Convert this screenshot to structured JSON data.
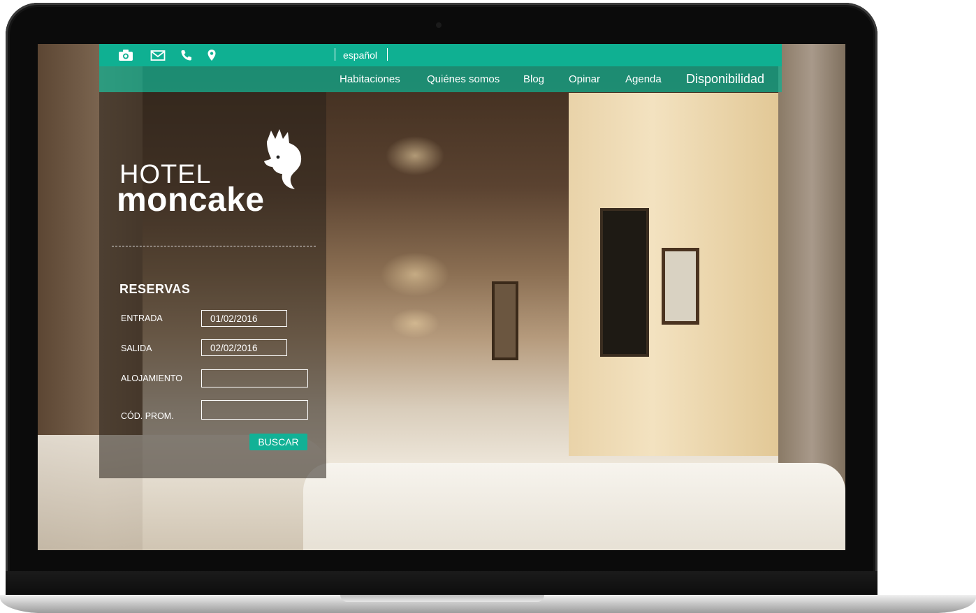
{
  "topbar": {
    "icons": [
      "camera-icon",
      "mail-icon",
      "phone-icon",
      "location-pin-icon"
    ],
    "language": "español"
  },
  "nav": {
    "items": [
      "Habitaciones",
      "Quiénes somos",
      "Blog",
      "Opinar",
      "Agenda",
      "Disponibilidad"
    ]
  },
  "brand": {
    "line1": "HOTEL",
    "line2": "moncake"
  },
  "booking": {
    "title": "RESERVAS",
    "fields": [
      {
        "label": "ENTRADA",
        "value": "01/02/2016"
      },
      {
        "label": "SALIDA",
        "value": "02/02/2016"
      },
      {
        "label": "ALOJAMIENTO",
        "value": ""
      },
      {
        "label": "CÓD. PROM.",
        "value": ""
      }
    ],
    "submit": "BUSCAR"
  },
  "colors": {
    "accent": "#0fb092"
  }
}
